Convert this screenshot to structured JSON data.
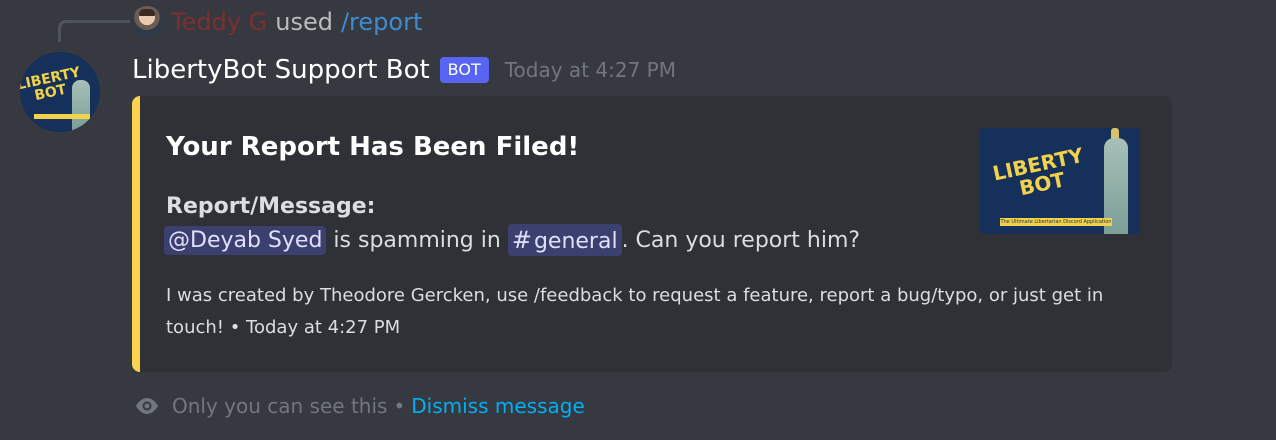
{
  "reply": {
    "username": "Teddy G",
    "used": "used",
    "command": "/report"
  },
  "message": {
    "bot_name": "LibertyBot Support Bot",
    "bot_tag": "BOT",
    "timestamp": "Today at 4:27 PM"
  },
  "embed": {
    "accent_color": "#fcd34d",
    "title": "Your Report Has Been Filed!",
    "field_name": "Report/Message:",
    "user_mention": "@Deyab Syed",
    "text_middle": " is spamming in ",
    "channel_hash": "#",
    "channel_name": "general",
    "text_end": ". Can you report him?",
    "footer": "I was created by Theodore Gercken, use /feedback to request a feature, report a bug/typo, or just get in touch! • Today at 4:27 PM",
    "thumbnail_alt": "LibertyBot logo",
    "logo_text_line1": "LIBERTY",
    "logo_text_line2": "BOT",
    "logo_banner": "The Ultimate Libertarian Discord Application"
  },
  "ephemeral": {
    "notice": "Only you can see this",
    "separator": "•",
    "dismiss": "Dismiss message"
  }
}
